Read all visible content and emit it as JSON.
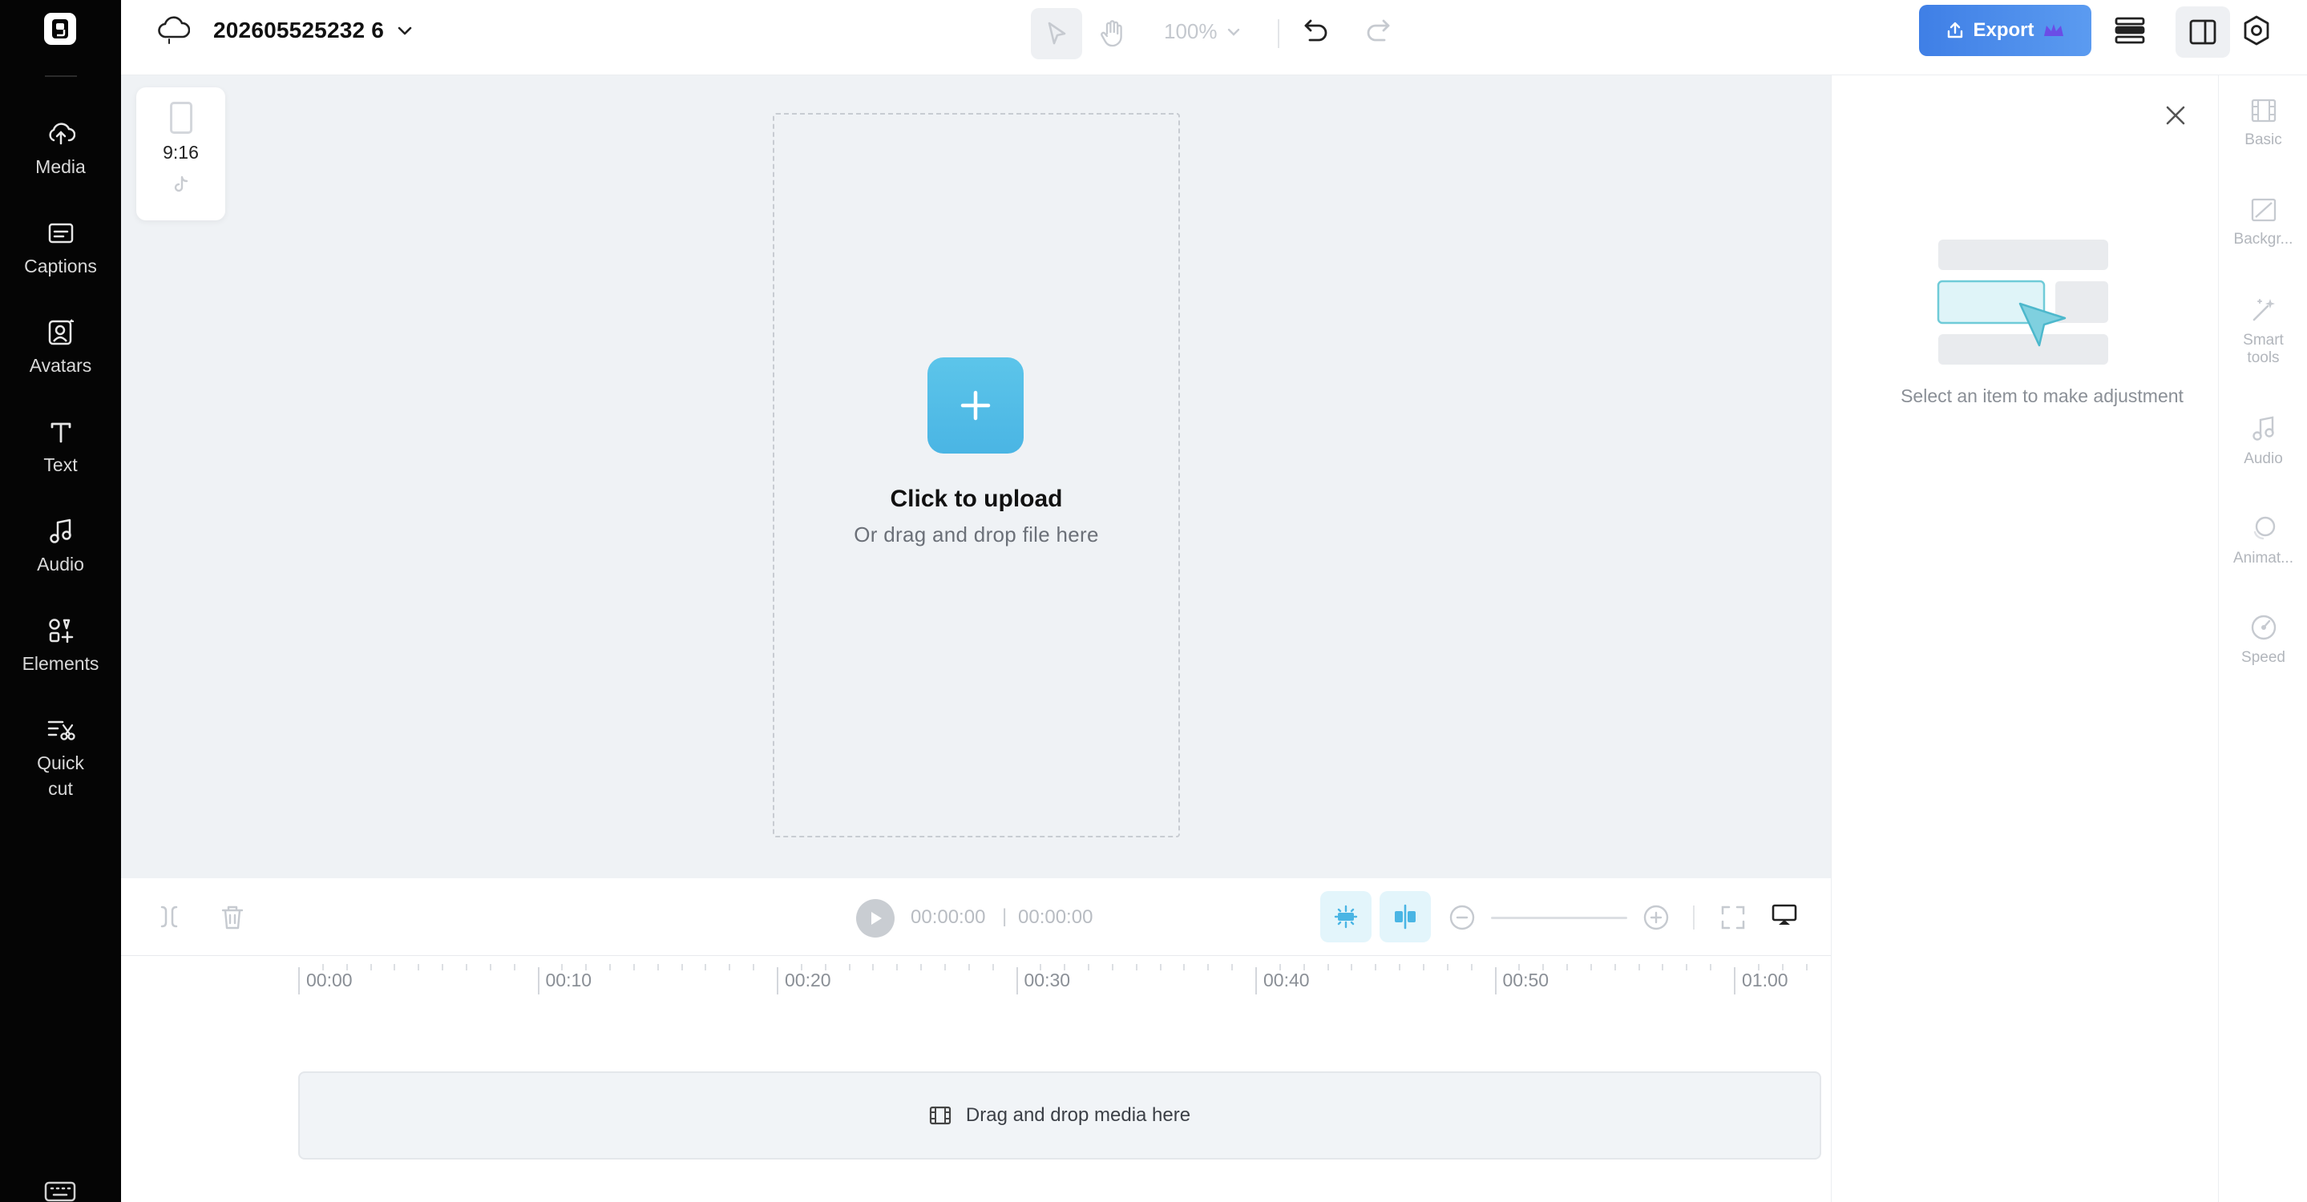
{
  "app": {
    "project_title": "202605525232 6"
  },
  "sidebar": {
    "items": [
      {
        "id": "media",
        "label": "Media",
        "icon": "cloud-upload-icon"
      },
      {
        "id": "captions",
        "label": "Captions",
        "icon": "captions-icon"
      },
      {
        "id": "avatars",
        "label": "Avatars",
        "icon": "avatar-icon"
      },
      {
        "id": "text",
        "label": "Text",
        "icon": "text-icon"
      },
      {
        "id": "audio",
        "label": "Audio",
        "icon": "music-note-icon"
      },
      {
        "id": "elements",
        "label": "Elements",
        "icon": "elements-icon"
      },
      {
        "id": "quick_cut",
        "label": "Quick cut",
        "icon": "scissors-icon"
      }
    ]
  },
  "toolbar": {
    "zoom": "100%",
    "export_label": "Export"
  },
  "canvas": {
    "aspect_ratio": "9:16",
    "upload_title": "Click to upload",
    "upload_subtitle": "Or drag and drop file here"
  },
  "playback": {
    "current_time": "00:00:00",
    "separator": "|",
    "total_time": "00:00:00"
  },
  "timeline": {
    "ticks": [
      "00:00",
      "00:10",
      "00:20",
      "00:30",
      "00:40",
      "00:50",
      "01:00"
    ],
    "drop_hint": "Drag and drop media here"
  },
  "properties": {
    "empty_message": "Select an item to make adjustment"
  },
  "right_tabs": {
    "items": [
      {
        "id": "basic",
        "label": "Basic",
        "icon": "film-icon"
      },
      {
        "id": "background",
        "label": "Backgr...",
        "icon": "background-icon"
      },
      {
        "id": "smart_tools",
        "label": "Smart tools",
        "icon": "magic-wand-icon"
      },
      {
        "id": "audio",
        "label": "Audio",
        "icon": "music-note-icon"
      },
      {
        "id": "animation",
        "label": "Animat...",
        "icon": "animation-icon"
      },
      {
        "id": "speed",
        "label": "Speed",
        "icon": "speedometer-icon"
      }
    ]
  },
  "colors": {
    "accent": "#4ab5e4",
    "export": "#4a8ae8",
    "sidebar_bg": "#050505",
    "canvas_bg": "#eff2f5"
  }
}
